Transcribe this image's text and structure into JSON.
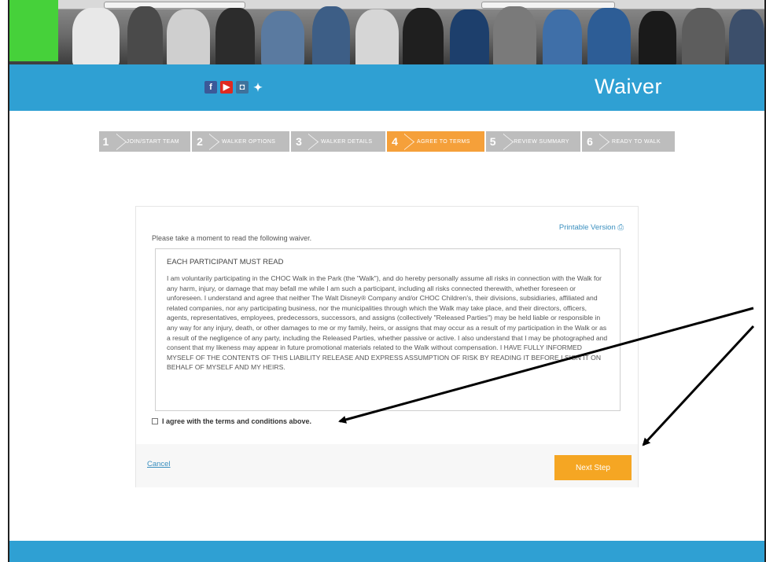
{
  "header": {
    "title": "Waiver",
    "social": [
      {
        "icon": "facebook-icon",
        "glyph": "f"
      },
      {
        "icon": "youtube-icon",
        "glyph": "▶"
      },
      {
        "icon": "instagram-icon",
        "glyph": "◘"
      },
      {
        "icon": "twitter-icon",
        "glyph": "🐦"
      }
    ]
  },
  "steps": [
    {
      "num": "1",
      "label": "JOIN/START TEAM",
      "active": false
    },
    {
      "num": "2",
      "label": "WALKER OPTIONS",
      "active": false
    },
    {
      "num": "3",
      "label": "WALKER DETAILS",
      "active": false
    },
    {
      "num": "4",
      "label": "AGREE TO TERMS",
      "active": true
    },
    {
      "num": "5",
      "label": "REVIEW SUMMARY",
      "active": false
    },
    {
      "num": "6",
      "label": "READY TO WALK",
      "active": false
    }
  ],
  "waiver": {
    "printable_label": "Printable Version",
    "printable_icon": "printer-icon",
    "intro": "Please take a moment to read the following waiver.",
    "heading": "EACH PARTICIPANT MUST READ",
    "body": "I am voluntarily participating in the CHOC Walk in the Park (the \"Walk\"), and do hereby personally assume all risks in connection with the Walk for any harm, injury, or damage that may befall me while I am such a participant, including all risks connected therewith, whether foreseen or unforeseen. I understand and agree that neither The Walt Disney® Company and/or CHOC Children's, their divisions, subsidiaries, affiliated and related companies, nor any participating business, nor the municipalities through which the Walk may take place, and their directors, officers, agents, representatives, employees, predecessors, successors, and assigns (collectively \"Released Parties\") may be held liable or responsible in any way for any injury, death, or other damages to me or my family, heirs, or assigns that may occur as a result of my participation in the Walk or as a result of the negligence of any party, including the Released Parties, whether passive or active. I also understand that I may be photographed and consent that my likeness may appear in future promotional materials related to the Walk without compensation. I HAVE FULLY INFORMED MYSELF OF THE CONTENTS OF THIS LIABILITY RELEASE AND EXPRESS ASSUMPTION OF RISK BY READING IT BEFORE I SIGN IT ON BEHALF OF MYSELF AND MY HEIRS.",
    "agree_label": "I agree with the terms and conditions above."
  },
  "actions": {
    "cancel_label": "Cancel",
    "next_label": "Next Step"
  },
  "colors": {
    "header_blue": "#2fa0d3",
    "step_active": "#f5a03a",
    "step_inactive": "#bdbdbd",
    "button_orange": "#f5a623",
    "link_blue": "#3a8fbf"
  }
}
